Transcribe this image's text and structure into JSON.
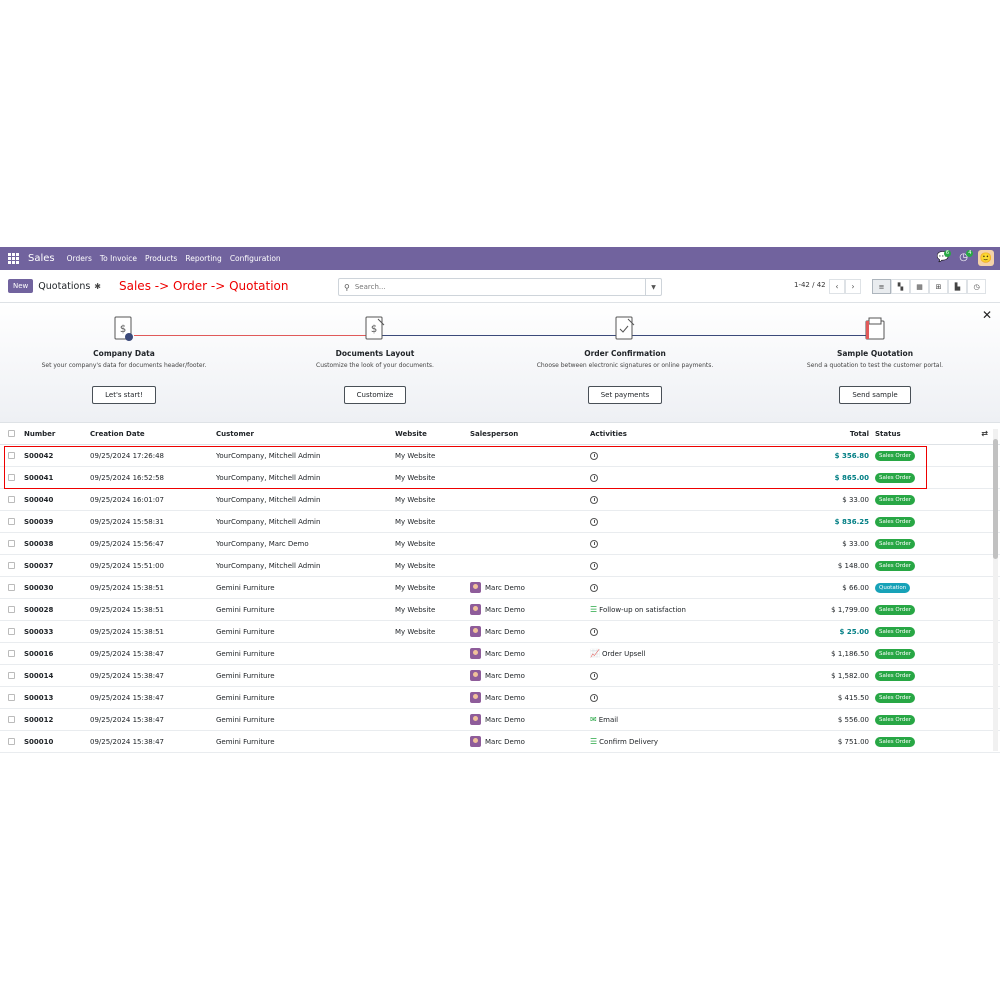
{
  "navbar": {
    "app_name": "Sales",
    "menu": [
      "Orders",
      "To Invoice",
      "Products",
      "Reporting",
      "Configuration"
    ],
    "chat_count": "6",
    "activity_count": "4"
  },
  "control": {
    "new_label": "New",
    "title": "Quotations",
    "annotation": "Sales -> Order -> Quotation",
    "search_placeholder": "Search...",
    "pager": "1-42 / 42"
  },
  "onboarding": {
    "steps": [
      {
        "title": "Company Data",
        "desc": "Set your company's data for documents header/footer.",
        "button": "Let's start!"
      },
      {
        "title": "Documents Layout",
        "desc": "Customize the look of your documents.",
        "button": "Customize"
      },
      {
        "title": "Order Confirmation",
        "desc": "Choose between electronic signatures or online payments.",
        "button": "Set payments"
      },
      {
        "title": "Sample Quotation",
        "desc": "Send a quotation to test the customer portal.",
        "button": "Send sample"
      }
    ]
  },
  "table": {
    "headers": {
      "number": "Number",
      "date": "Creation Date",
      "customer": "Customer",
      "website": "Website",
      "salesperson": "Salesperson",
      "activities": "Activities",
      "total": "Total",
      "status": "Status"
    },
    "rows": [
      {
        "number": "S00042",
        "date": "09/25/2024 17:26:48",
        "customer": "YourCompany, Mitchell Admin",
        "website": "My Website",
        "salesperson": "",
        "activity": "",
        "activity_icon": "clock-icon",
        "total": "$ 356.80",
        "total_highlight": true,
        "status": "Sales Order"
      },
      {
        "number": "S00041",
        "date": "09/25/2024 16:52:58",
        "customer": "YourCompany, Mitchell Admin",
        "website": "My Website",
        "salesperson": "",
        "activity": "",
        "activity_icon": "clock-icon",
        "total": "$ 865.00",
        "total_highlight": true,
        "status": "Sales Order"
      },
      {
        "number": "S00040",
        "date": "09/25/2024 16:01:07",
        "customer": "YourCompany, Mitchell Admin",
        "website": "My Website",
        "salesperson": "",
        "activity": "",
        "activity_icon": "clock-icon",
        "total": "$ 33.00",
        "total_highlight": false,
        "status": "Sales Order"
      },
      {
        "number": "S00039",
        "date": "09/25/2024 15:58:31",
        "customer": "YourCompany, Mitchell Admin",
        "website": "My Website",
        "salesperson": "",
        "activity": "",
        "activity_icon": "clock-icon",
        "total": "$ 836.25",
        "total_highlight": true,
        "status": "Sales Order"
      },
      {
        "number": "S00038",
        "date": "09/25/2024 15:56:47",
        "customer": "YourCompany, Marc Demo",
        "website": "My Website",
        "salesperson": "",
        "activity": "",
        "activity_icon": "clock-icon",
        "total": "$ 33.00",
        "total_highlight": false,
        "status": "Sales Order"
      },
      {
        "number": "S00037",
        "date": "09/25/2024 15:51:00",
        "customer": "YourCompany, Mitchell Admin",
        "website": "My Website",
        "salesperson": "",
        "activity": "",
        "activity_icon": "clock-icon",
        "total": "$ 148.00",
        "total_highlight": false,
        "status": "Sales Order"
      },
      {
        "number": "S00030",
        "date": "09/25/2024 15:38:51",
        "customer": "Gemini Furniture",
        "website": "My Website",
        "salesperson": "Marc Demo",
        "activity": "",
        "activity_icon": "clock-icon",
        "total": "$ 66.00",
        "total_highlight": false,
        "status": "Quotation"
      },
      {
        "number": "S00028",
        "date": "09/25/2024 15:38:51",
        "customer": "Gemini Furniture",
        "website": "My Website",
        "salesperson": "Marc Demo",
        "activity": "Follow-up on satisfaction",
        "activity_icon": "tasks-icon",
        "total": "$ 1,799.00",
        "total_highlight": false,
        "status": "Sales Order"
      },
      {
        "number": "S00033",
        "date": "09/25/2024 15:38:51",
        "customer": "Gemini Furniture",
        "website": "My Website",
        "salesperson": "Marc Demo",
        "activity": "",
        "activity_icon": "clock-icon",
        "total": "$ 25.00",
        "total_highlight": true,
        "status": "Sales Order"
      },
      {
        "number": "S00016",
        "date": "09/25/2024 15:38:47",
        "customer": "Gemini Furniture",
        "website": "",
        "salesperson": "Marc Demo",
        "activity": "Order Upsell",
        "activity_icon": "chart-line-icon",
        "total": "$ 1,186.50",
        "total_highlight": false,
        "status": "Sales Order"
      },
      {
        "number": "S00014",
        "date": "09/25/2024 15:38:47",
        "customer": "Gemini Furniture",
        "website": "",
        "salesperson": "Marc Demo",
        "activity": "",
        "activity_icon": "clock-icon",
        "total": "$ 1,582.00",
        "total_highlight": false,
        "status": "Sales Order"
      },
      {
        "number": "S00013",
        "date": "09/25/2024 15:38:47",
        "customer": "Gemini Furniture",
        "website": "",
        "salesperson": "Marc Demo",
        "activity": "",
        "activity_icon": "clock-icon",
        "total": "$ 415.50",
        "total_highlight": false,
        "status": "Sales Order"
      },
      {
        "number": "S00012",
        "date": "09/25/2024 15:38:47",
        "customer": "Gemini Furniture",
        "website": "",
        "salesperson": "Marc Demo",
        "activity": "Email",
        "activity_icon": "envelope-icon",
        "total": "$ 556.00",
        "total_highlight": false,
        "status": "Sales Order"
      },
      {
        "number": "S00010",
        "date": "09/25/2024 15:38:47",
        "customer": "Gemini Furniture",
        "website": "",
        "salesperson": "Marc Demo",
        "activity": "Confirm Delivery",
        "activity_icon": "tasks-icon",
        "total": "$ 751.00",
        "total_highlight": false,
        "status": "Sales Order"
      }
    ]
  },
  "colors": {
    "brand": "#71639e",
    "link_total": "#017e84",
    "status_sales_order": "#28a745",
    "status_quotation": "#17a2b8",
    "annotation_red": "#e00000"
  }
}
